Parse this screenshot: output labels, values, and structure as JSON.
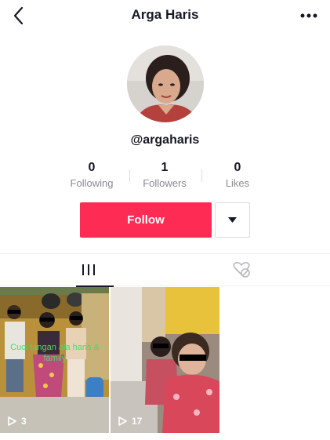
{
  "header": {
    "title": "Arga Haris",
    "back_icon": "back-arrow-icon",
    "more_icon": "more-dots-icon"
  },
  "profile": {
    "username": "@argaharis"
  },
  "stats": [
    {
      "value": "0",
      "label": "Following"
    },
    {
      "value": "1",
      "label": "Followers"
    },
    {
      "value": "0",
      "label": "Likes"
    }
  ],
  "actions": {
    "follow_label": "Follow",
    "dropdown_icon": "caret-down-icon"
  },
  "tabs": [
    {
      "name": "videos",
      "icon": "grid-icon",
      "active": true
    },
    {
      "name": "liked",
      "icon": "hidden-heart-icon",
      "active": false
    }
  ],
  "videos": [
    {
      "caption": "Cuci tangan ala haris & family",
      "play_count": "3"
    },
    {
      "caption": "",
      "play_count": "17"
    }
  ],
  "colors": {
    "accent": "#fe2c55",
    "text": "#161823",
    "secondary_text": "#8a8b91",
    "caption_green": "#4cd964"
  }
}
